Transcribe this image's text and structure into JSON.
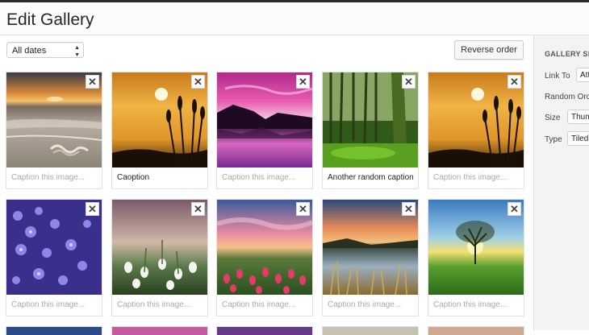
{
  "header": {
    "title": "Edit Gallery"
  },
  "toolbar": {
    "date_filter": "All dates",
    "reverse_label": "Reverse order"
  },
  "gallery": {
    "close_glyph": "✕",
    "captions": [
      "Caption this image...",
      "Caoption",
      "Caption this image...",
      "Another random caption",
      "Caption this image...",
      "Caption this image...",
      "Caption this image...",
      "Caption this image...",
      "Caption this image...",
      "Caption this image..."
    ],
    "captions_filled": [
      false,
      true,
      false,
      true,
      false,
      false,
      false,
      false,
      false,
      false
    ],
    "image_subjects": [
      "beach-sunset",
      "wheat-sunset",
      "purple-lake",
      "green-forest",
      "wheat-sunset",
      "blue-flowers",
      "snowdrops",
      "tulip-field",
      "lake-grass",
      "lone-tree"
    ]
  },
  "sidebar": {
    "title": "GALLERY SETTINGS",
    "link_to_label": "Link To",
    "link_to_value": "Attachment Page",
    "random_order_label": "Random Order",
    "size_label": "Size",
    "size_value": "Thumbnail",
    "type_label": "Type",
    "type_value": "Tiled Mosaic"
  },
  "colors": {
    "panel_bg": "#f3f3f3",
    "tile_border": "#e2e2e2",
    "placeholder": "#aaaaaa"
  }
}
